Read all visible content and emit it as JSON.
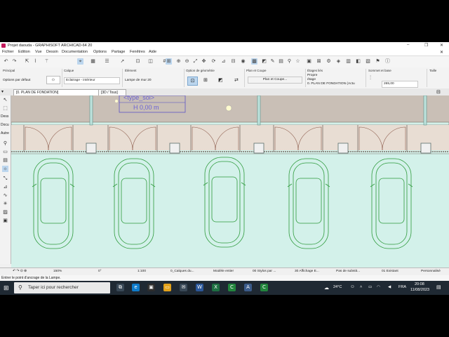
{
  "window": {
    "title": "Projet daouda - GRAPHISOFT ARCHICAD-64 20",
    "controls": [
      "–",
      "❐",
      "✕"
    ]
  },
  "menu": [
    "Fichier",
    "Edition",
    "Vue",
    "Dessin",
    "Documentation",
    "Options",
    "Partage",
    "Fenêtres",
    "Aide"
  ],
  "infobox": {
    "principal_label": "Principal",
    "principal_value": "Options par défaut",
    "calque_label": "Calque",
    "calque_value": "Eclairage - intérieur",
    "element_label": "Élément",
    "element_value": "Lampe de mur 20",
    "geometrie_label": "Option de géométrie",
    "plan_coupe_label": "Plan et Coupe",
    "plan_coupe_value": "Plan et Coupe...",
    "etages_label": "Étages liés",
    "etages_value1": "Propre",
    "etages_value2": "étage",
    "etages_value3": "0. PLAN DE FONDATION (Actu",
    "sommet_label": "Sommet et base",
    "sommet_value": "265,00",
    "taille_label": "Taille"
  },
  "tabs": {
    "tab1": "[0. PLAN DE FONDATION]",
    "tab2": "[3D / Tous]"
  },
  "toolbox": {
    "dess": "Dess",
    "docu": "Docu",
    "autre": "Autre"
  },
  "canvas": {
    "label_type": "<type_sol>",
    "label_h": "H  0,00 m"
  },
  "status": {
    "zoom": "150%",
    "angle": "0°",
    "scale": "1:100",
    "calques": "0_Calques du...",
    "modele": "Modèle entier",
    "stylos": "00 Stylos par ...",
    "affichage": "30 Affichage E...",
    "substitution": "Pas de substit...",
    "existant": "01 Existant",
    "personnalise": "Personnalisé"
  },
  "hint": "Entrer le point d'ancrage de la Lampe.",
  "taskbar": {
    "search_placeholder": "Taper ici pour rechercher",
    "temperature": "24°C",
    "language": "FRA",
    "time": "20:08",
    "date": "11/08/2023"
  },
  "colors": {
    "canvas_bg": "#d3f1ea",
    "wall_fill": "#c9bfb6",
    "car_stroke": "#2e9b3c",
    "label_stroke": "#4e46c8",
    "door_stroke": "#8b5a4a",
    "taskbar": "#1f2933"
  }
}
